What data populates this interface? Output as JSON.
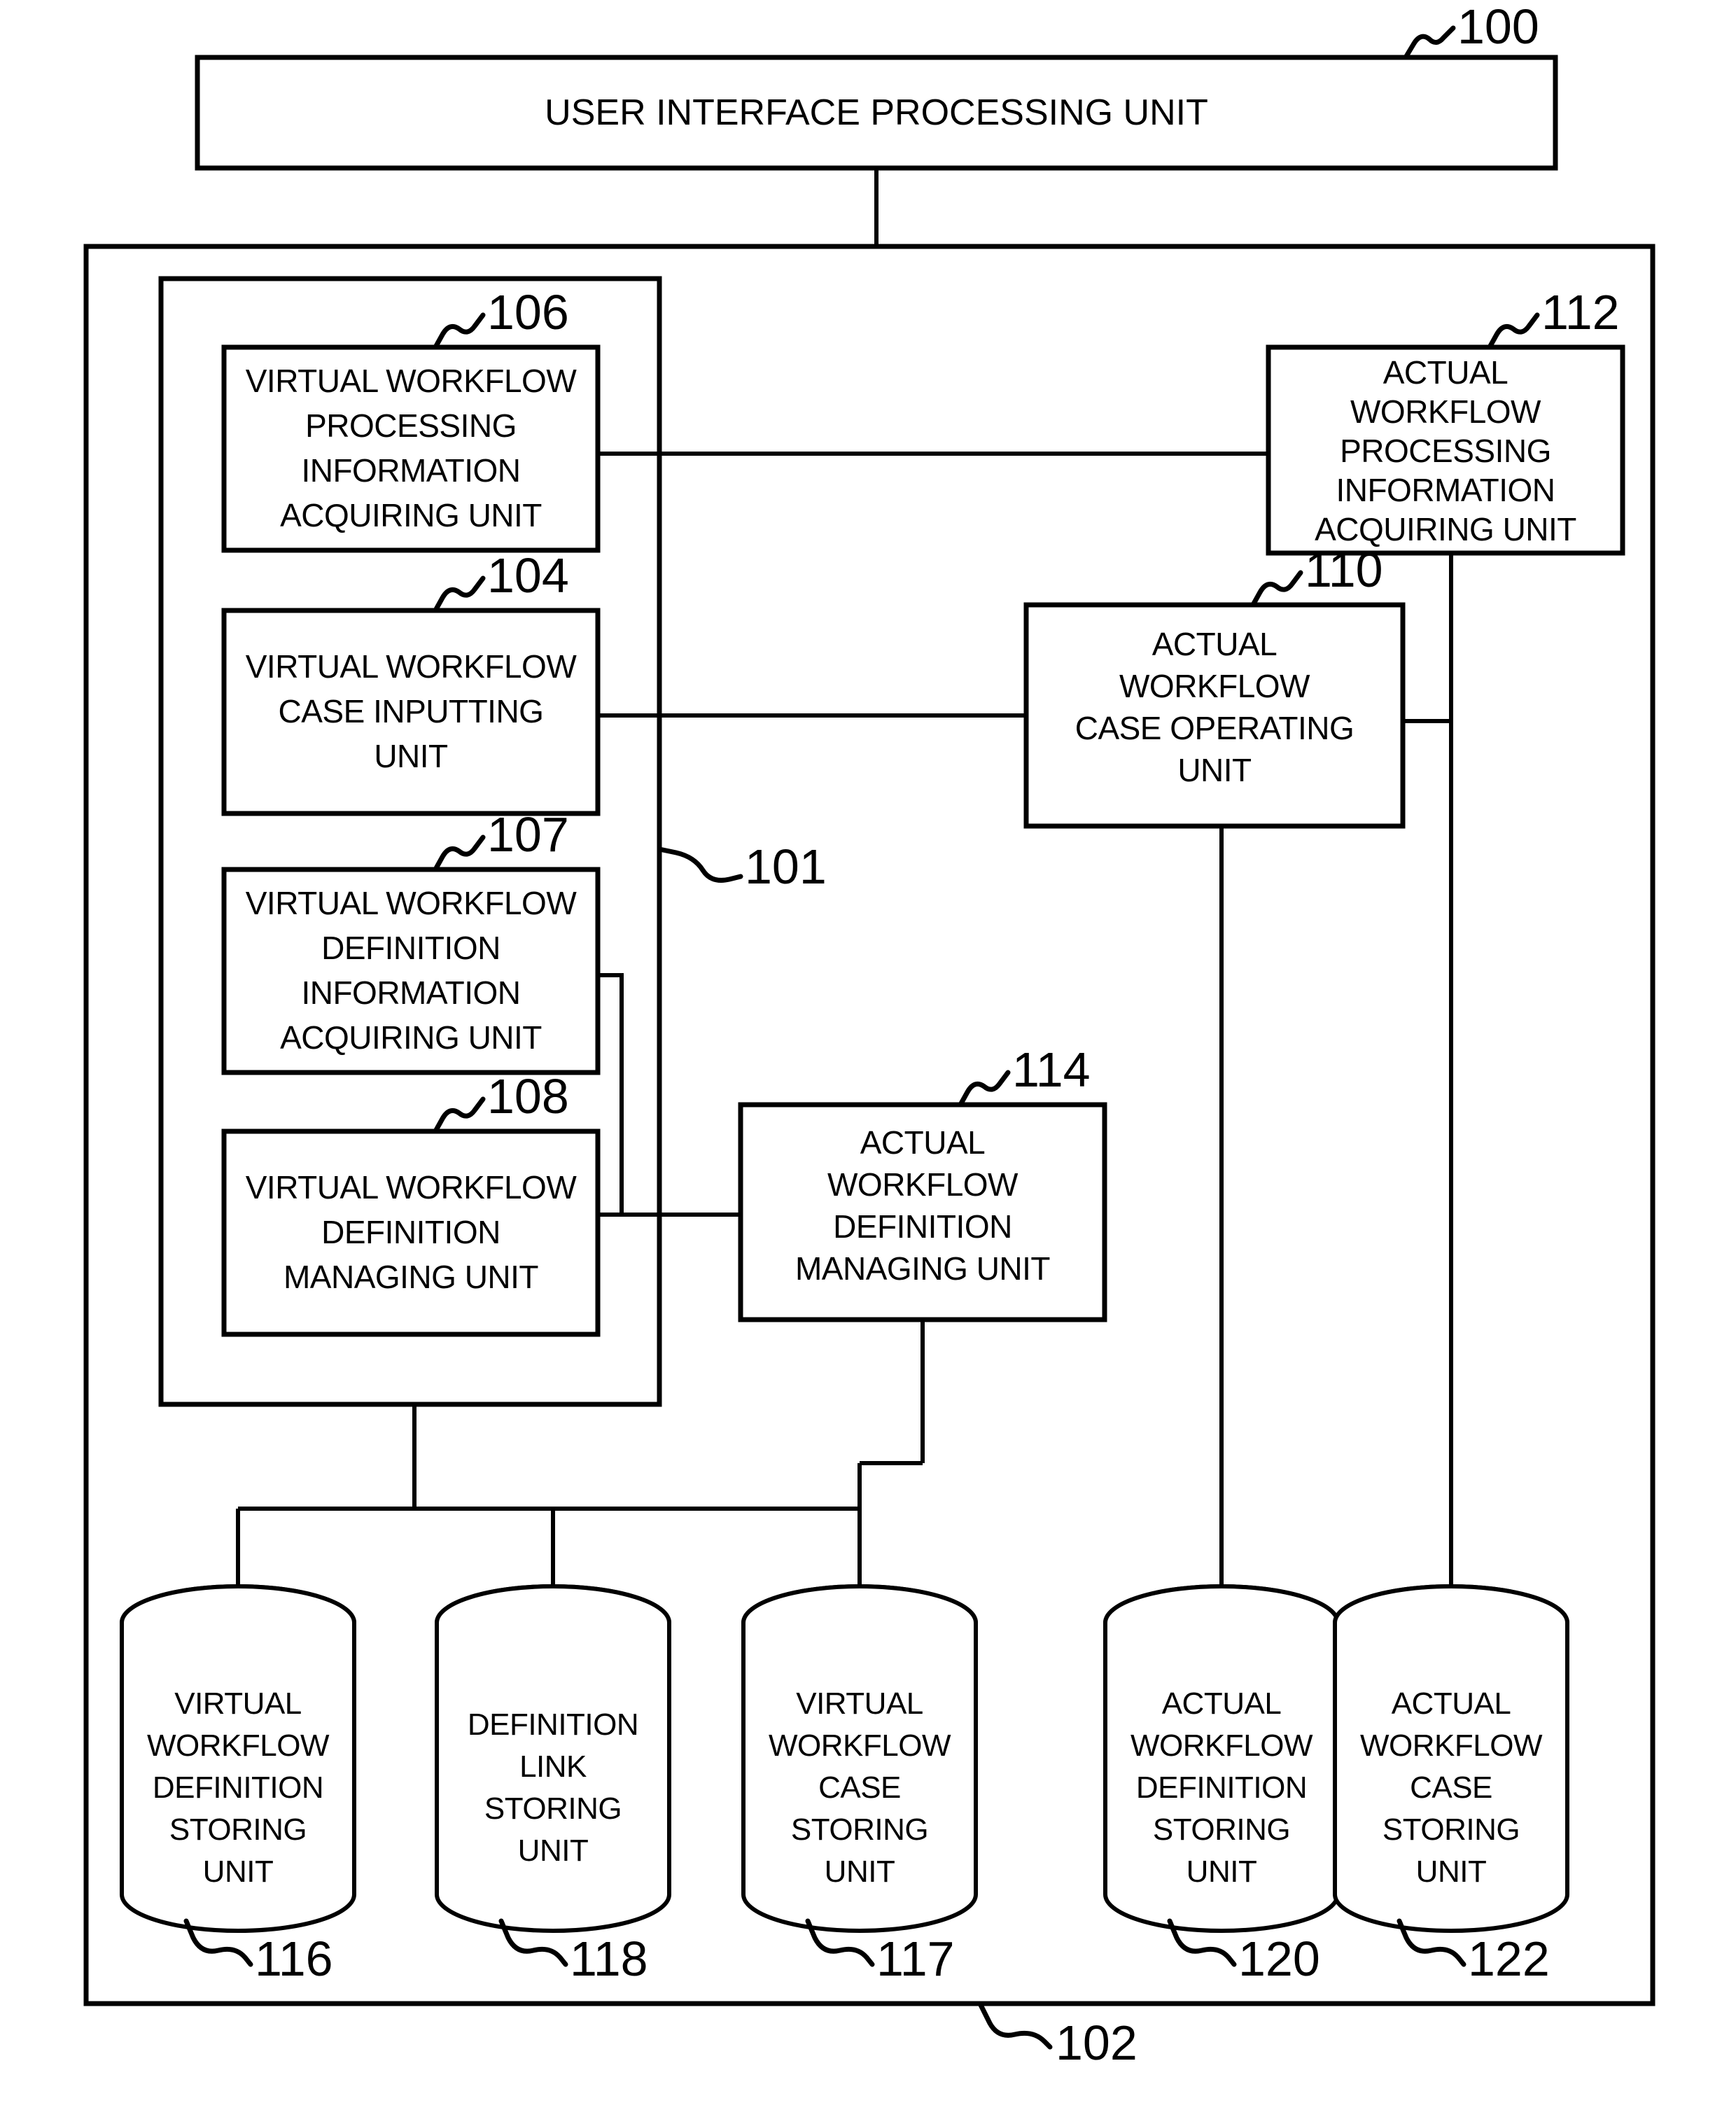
{
  "figure": {
    "type": "patent-block-diagram",
    "banner": {
      "label": "USER INTERFACE PROCESSING UNIT",
      "ref": "100"
    },
    "outer_frame": {
      "ref": "102"
    },
    "inner_frame": {
      "ref": "101"
    },
    "boxes": [
      {
        "id": "box-106",
        "ref": "106",
        "lines": [
          "VIRTUAL WORKFLOW",
          "PROCESSING",
          "INFORMATION",
          "ACQUIRING UNIT"
        ]
      },
      {
        "id": "box-104",
        "ref": "104",
        "lines": [
          "VIRTUAL WORKFLOW",
          "CASE INPUTTING",
          "UNIT"
        ]
      },
      {
        "id": "box-107",
        "ref": "107",
        "lines": [
          "VIRTUAL WORKFLOW",
          "DEFINITION",
          "INFORMATION",
          "ACQUIRING UNIT"
        ]
      },
      {
        "id": "box-108",
        "ref": "108",
        "lines": [
          "VIRTUAL WORKFLOW",
          "DEFINITION",
          "MANAGING UNIT"
        ]
      },
      {
        "id": "box-112",
        "ref": "112",
        "lines": [
          "ACTUAL",
          "WORKFLOW",
          "PROCESSING",
          "INFORMATION",
          "ACQUIRING UNIT"
        ]
      },
      {
        "id": "box-110",
        "ref": "110",
        "lines": [
          "ACTUAL",
          "WORKFLOW",
          "CASE OPERATING",
          "UNIT"
        ]
      },
      {
        "id": "box-114",
        "ref": "114",
        "lines": [
          "ACTUAL",
          "WORKFLOW",
          "DEFINITION",
          "MANAGING UNIT"
        ]
      }
    ],
    "cylinders": [
      {
        "id": "cyl-116",
        "ref": "116",
        "lines": [
          "VIRTUAL",
          "WORKFLOW",
          "DEFINITION",
          "STORING",
          "UNIT"
        ]
      },
      {
        "id": "cyl-118",
        "ref": "118",
        "lines": [
          "DEFINITION",
          "LINK",
          "STORING",
          "UNIT"
        ]
      },
      {
        "id": "cyl-117",
        "ref": "117",
        "lines": [
          "VIRTUAL",
          "WORKFLOW",
          "CASE",
          "STORING",
          "UNIT"
        ]
      },
      {
        "id": "cyl-120",
        "ref": "120",
        "lines": [
          "ACTUAL",
          "WORKFLOW",
          "DEFINITION",
          "STORING",
          "UNIT"
        ]
      },
      {
        "id": "cyl-122",
        "ref": "122",
        "lines": [
          "ACTUAL",
          "WORKFLOW",
          "CASE",
          "STORING",
          "UNIT"
        ]
      }
    ],
    "colors": {
      "ink": "#000000",
      "paper": "#ffffff"
    }
  }
}
